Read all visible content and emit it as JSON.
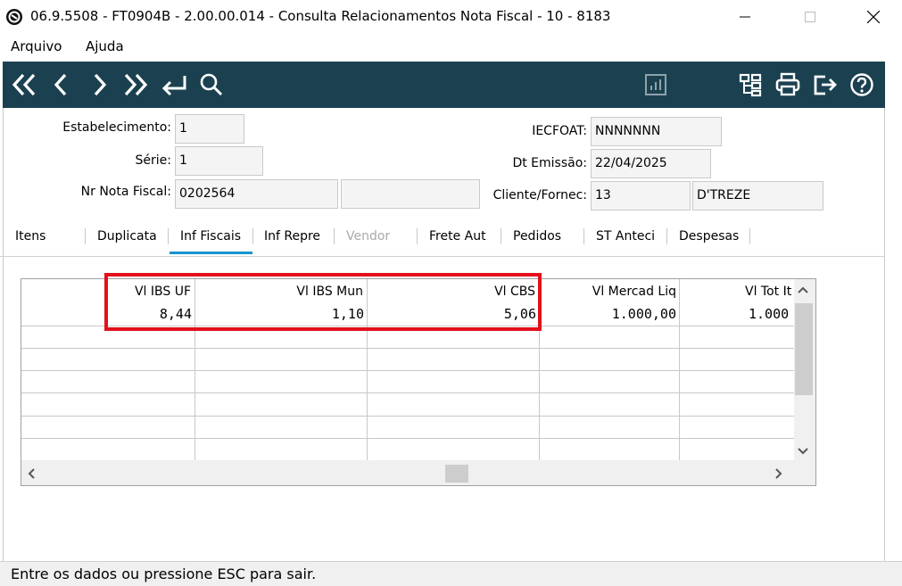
{
  "window": {
    "title": "06.9.5508 - FT0904B - 2.00.00.014 - Consulta Relacionamentos Nota Fiscal - 10 - 8183",
    "minimize": "—",
    "maximize": "☐",
    "close": "✕"
  },
  "menu": {
    "items": [
      "Arquivo",
      "Ajuda"
    ]
  },
  "toolbar": {
    "left_icons": [
      "first-record-icon",
      "previous-record-icon",
      "next-record-icon",
      "last-record-icon",
      "return-icon",
      "search-icon"
    ],
    "right_icons": [
      "chart-icon",
      "tree-icon",
      "print-icon",
      "exit-icon",
      "help-icon"
    ],
    "icon_color": "#ffffff",
    "background": "#1b4150"
  },
  "form": {
    "estabelecimento_label": "Estabelecimento:",
    "estabelecimento_value": "1",
    "serie_label": "Série:",
    "serie_value": "1",
    "nr_nota_label": "Nr Nota Fiscal:",
    "nr_nota_value": "0202564",
    "nr_nota_extra_1": "",
    "nr_nota_extra_2": "",
    "iecfoat_label": "IECFOAT:",
    "iecfoat_value": "NNNNNNN",
    "dt_emissao_label": "Dt Emissão:",
    "dt_emissao_value": "22/04/2025",
    "cliente_label": "Cliente/Fornec:",
    "cliente_code": "13",
    "cliente_name": "D'TREZE"
  },
  "tabs": [
    {
      "label": "Itens"
    },
    {
      "label": "Duplicata"
    },
    {
      "label": "Inf Fiscais"
    },
    {
      "label": "Inf Repre"
    },
    {
      "label": "Vendor"
    },
    {
      "label": "Frete Aut"
    },
    {
      "label": "Pedidos"
    },
    {
      "label": "ST Anteci"
    },
    {
      "label": "Despesas"
    }
  ],
  "active_tab": "Inf Fiscais",
  "grid": {
    "columns": [
      "Vl IBS UF",
      "Vl IBS Mun",
      "Vl CBS",
      "Vl Mercad Liq",
      "Vl Tot It"
    ],
    "rows": [
      [
        "8,44",
        "1,10",
        "5,06",
        "1.000,00",
        "1.000"
      ]
    ]
  },
  "status": {
    "text": "Entre os dados ou pressione ESC para sair."
  },
  "colors": {
    "highlight": "#e3101a",
    "tab_underline": "#1793d1",
    "disabled_text": "#a9a9a9"
  }
}
